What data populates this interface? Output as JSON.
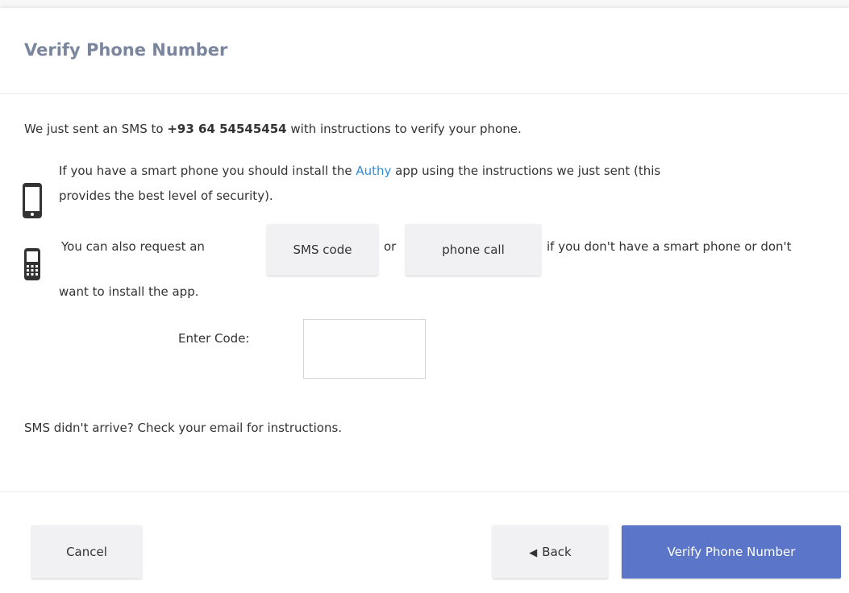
{
  "title": "Verify Phone Number",
  "sms_sent": {
    "prefix": "We just sent an SMS to ",
    "phone": "+93 64 54545454",
    "suffix": " with instructions to verify your phone."
  },
  "smartphone": {
    "icon": "smartphone-icon",
    "line1_prefix": "If you have a smart phone you should install the ",
    "authy_link": "Authy",
    "line1_suffix": " app using the instructions we just sent (this",
    "line2": "provides the best level of security)."
  },
  "feature_phone": {
    "icon": "feature-phone-icon",
    "prefix": "You can also request an",
    "sms_code_button": "SMS code",
    "or": "or",
    "phone_call_button": "phone call",
    "suffix": "if you don't have a smart phone or don't",
    "line2": "want to install the app."
  },
  "code": {
    "label": "Enter Code:",
    "value": ""
  },
  "help_text": "SMS didn't arrive? Check your email for instructions.",
  "footer": {
    "cancel_label": "Cancel",
    "back_label": "Back",
    "verify_label": "Verify Phone Number"
  },
  "colors": {
    "title": "#7a869e",
    "link": "#2f8fd8",
    "primary_button": "#5b76c8",
    "secondary_button": "#f1f1f3"
  }
}
